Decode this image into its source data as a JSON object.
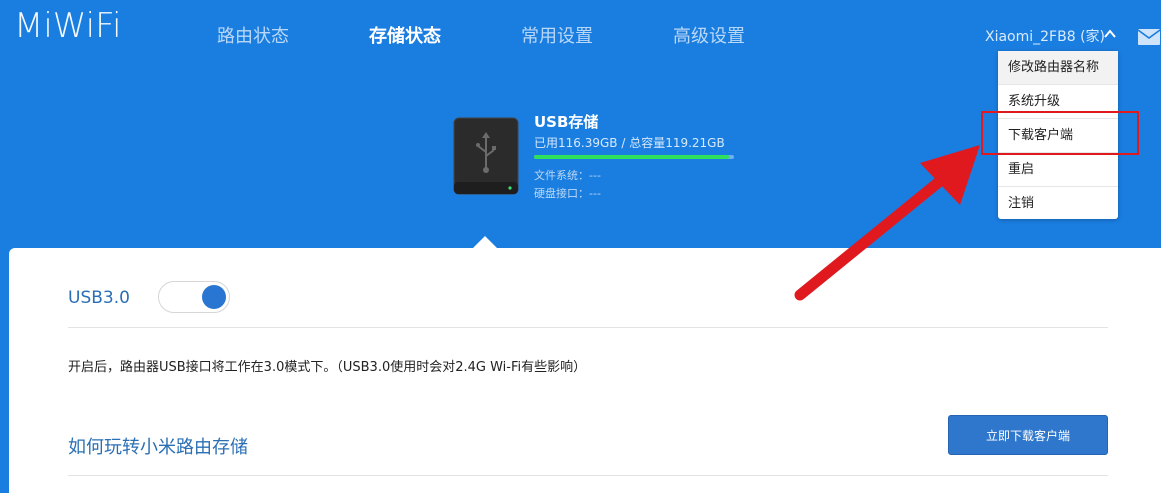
{
  "brand": {
    "logo_text": "MiWiFi"
  },
  "nav": {
    "items": [
      {
        "label": "路由状态"
      },
      {
        "label": "存储状态"
      },
      {
        "label": "常用设置"
      },
      {
        "label": "高级设置"
      }
    ],
    "active": "存储状态"
  },
  "user": {
    "router_name": "Xiaomi_2FB8 (家)",
    "chevron": "chevron-up-icon",
    "mail_icon": "mail-icon"
  },
  "storage": {
    "title": "USB存储",
    "usage_text": "已用116.39GB / 总容量119.21GB",
    "usage_fraction": 0.976,
    "filesystem_label": "文件系统：---",
    "interface_label": "硬盘接口：---"
  },
  "usb3": {
    "label": "USB3.0",
    "enabled": true,
    "description": "开启后，路由器USB接口将工作在3.0模式下。（USB3.0使用时会对2.4G Wi-Fi有些影响）"
  },
  "guide": {
    "title": "如何玩转小米路由存储",
    "download_button": "立即下载客户端"
  },
  "dropdown": {
    "items": [
      {
        "label": "修改路由器名称"
      },
      {
        "label": "系统升级"
      },
      {
        "label": "下载客户端"
      },
      {
        "label": "重启"
      },
      {
        "label": "注销"
      }
    ]
  },
  "colors": {
    "header_bg": "#1a7de0",
    "accent": "#2876d1",
    "progress": "#2ee05b",
    "annotation": "#e0191f"
  }
}
